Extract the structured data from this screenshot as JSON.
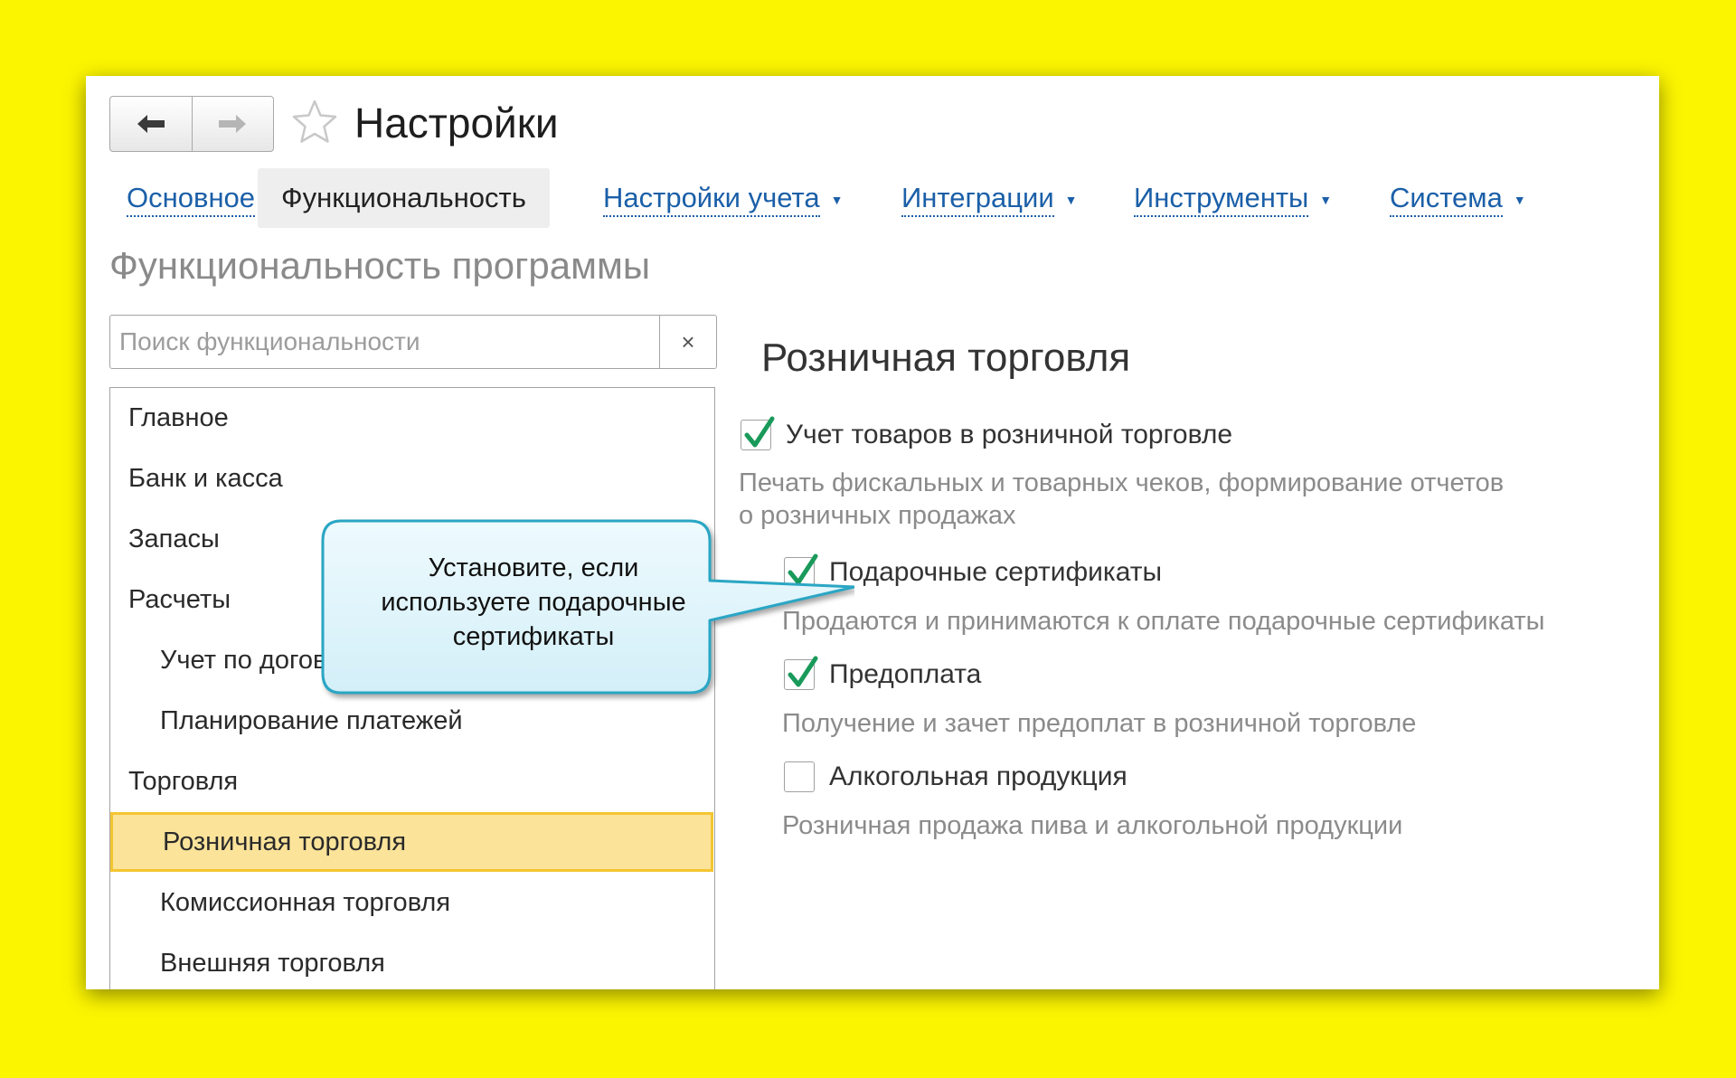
{
  "window": {
    "title": "Настройки",
    "nav": {
      "back": "back-arrow-icon",
      "forward": "forward-arrow-icon"
    }
  },
  "tabs": [
    {
      "label": "Основное",
      "has_dropdown": false
    },
    {
      "label": "Функциональность",
      "has_dropdown": false,
      "active": true
    },
    {
      "label": "Настройки учета",
      "has_dropdown": true
    },
    {
      "label": "Интеграции",
      "has_dropdown": true
    },
    {
      "label": "Инструменты",
      "has_dropdown": true
    },
    {
      "label": "Система",
      "has_dropdown": true
    }
  ],
  "section_title": "Функциональность программы",
  "search": {
    "placeholder": "Поиск функциональности",
    "value": "",
    "clear": "×"
  },
  "tree": [
    {
      "label": "Главное",
      "level": 0
    },
    {
      "label": "Банк и касса",
      "level": 0
    },
    {
      "label": "Запасы",
      "level": 0
    },
    {
      "label": "Расчеты",
      "level": 0
    },
    {
      "label": "Учет по договорам",
      "level": 1
    },
    {
      "label": "Планирование платежей",
      "level": 1
    },
    {
      "label": "Торговля",
      "level": 0
    },
    {
      "label": "Розничная торговля",
      "level": 1,
      "selected": true
    },
    {
      "label": "Комиссионная торговля",
      "level": 1
    },
    {
      "label": "Внешняя торговля",
      "level": 1
    }
  ],
  "callout": {
    "lines": [
      "Установите, если",
      "используете подарочные",
      "сертификаты"
    ]
  },
  "panel": {
    "title": "Розничная торговля",
    "options": [
      {
        "label": "Учет товаров в розничной торговле",
        "checked": true,
        "description": [
          "Печать фискальных и товарных чеков, формирование отчетов",
          "о розничных продажах"
        ]
      },
      {
        "label": "Подарочные сертификаты",
        "checked": true,
        "description": [
          "Продаются и принимаются к оплате подарочные сертификаты"
        ]
      },
      {
        "label": "Предоплата",
        "checked": true,
        "description": [
          "Получение и зачет предоплат в розничной торговле"
        ]
      },
      {
        "label": "Алкогольная продукция",
        "checked": false,
        "description": [
          "Розничная продажа пива и алкогольной продукции"
        ]
      }
    ]
  },
  "colors": {
    "background": "#fcf500",
    "link": "#1b5fa8",
    "selected_row": "#fbe39a",
    "selected_border": "#f3c530",
    "checkmark": "#1a9a5a",
    "callout_fill": "#dff4fb",
    "callout_border": "#2aa6c4"
  }
}
